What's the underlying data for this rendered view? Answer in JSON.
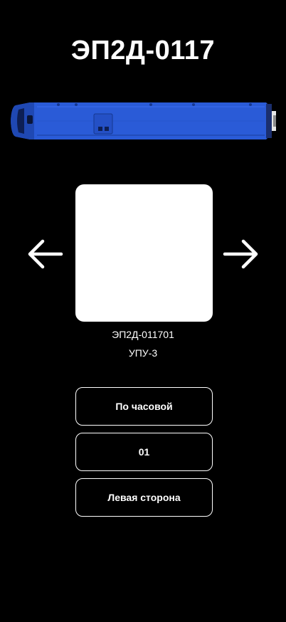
{
  "header": {
    "title": "ЭП2Д-0117"
  },
  "train": {
    "icon": "train-top-view-icon",
    "color": "#2a5bd7"
  },
  "carousel": {
    "prev_icon": "arrow-left-icon",
    "next_icon": "arrow-right-icon",
    "code_id": "ЭП2Д-011701",
    "code_type": "УПУ-3"
  },
  "options": {
    "direction": "По часовой",
    "number": "01",
    "side": "Левая сторона"
  }
}
